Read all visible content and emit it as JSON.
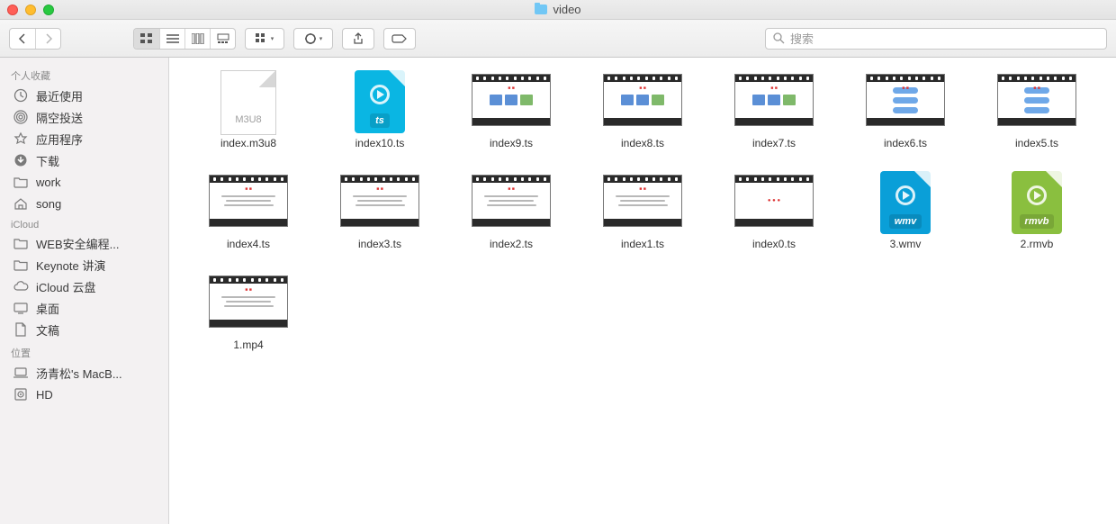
{
  "window": {
    "title": "video"
  },
  "search": {
    "placeholder": "搜索"
  },
  "sidebar": {
    "sections": [
      {
        "header": "个人收藏",
        "items": [
          {
            "icon": "clock",
            "label": "最近使用"
          },
          {
            "icon": "airdrop",
            "label": "隔空投送"
          },
          {
            "icon": "apps",
            "label": "应用程序"
          },
          {
            "icon": "download",
            "label": "下载"
          },
          {
            "icon": "folder",
            "label": "work"
          },
          {
            "icon": "home",
            "label": "song"
          }
        ]
      },
      {
        "header": "iCloud",
        "items": [
          {
            "icon": "folder",
            "label": "WEB安全编程..."
          },
          {
            "icon": "folder",
            "label": "Keynote 讲演"
          },
          {
            "icon": "cloud",
            "label": "iCloud 云盘"
          },
          {
            "icon": "desktop",
            "label": "桌面"
          },
          {
            "icon": "doc",
            "label": "文稿"
          }
        ]
      },
      {
        "header": "位置",
        "items": [
          {
            "icon": "laptop",
            "label": "汤青松's MacB..."
          },
          {
            "icon": "disk",
            "label": "HD"
          }
        ]
      }
    ]
  },
  "files": [
    {
      "name": "index.m3u8",
      "kind": "m3u8",
      "ext_label": "M3U8"
    },
    {
      "name": "index10.ts",
      "kind": "ts",
      "tag": "ts"
    },
    {
      "name": "index9.ts",
      "kind": "vthumb_blocks"
    },
    {
      "name": "index8.ts",
      "kind": "vthumb_blocks"
    },
    {
      "name": "index7.ts",
      "kind": "vthumb_blocks"
    },
    {
      "name": "index6.ts",
      "kind": "vthumb_ovals"
    },
    {
      "name": "index5.ts",
      "kind": "vthumb_ovals"
    },
    {
      "name": "index4.ts",
      "kind": "vthumb_lines"
    },
    {
      "name": "index3.ts",
      "kind": "vthumb_lines"
    },
    {
      "name": "index2.ts",
      "kind": "vthumb_lines"
    },
    {
      "name": "index1.ts",
      "kind": "vthumb_lines"
    },
    {
      "name": "index0.ts",
      "kind": "vthumb_red"
    },
    {
      "name": "3.wmv",
      "kind": "wmv",
      "tag": "wmv"
    },
    {
      "name": "2.rmvb",
      "kind": "rmvb",
      "tag": "rmvb"
    },
    {
      "name": "1.mp4",
      "kind": "vthumb_lines"
    }
  ]
}
